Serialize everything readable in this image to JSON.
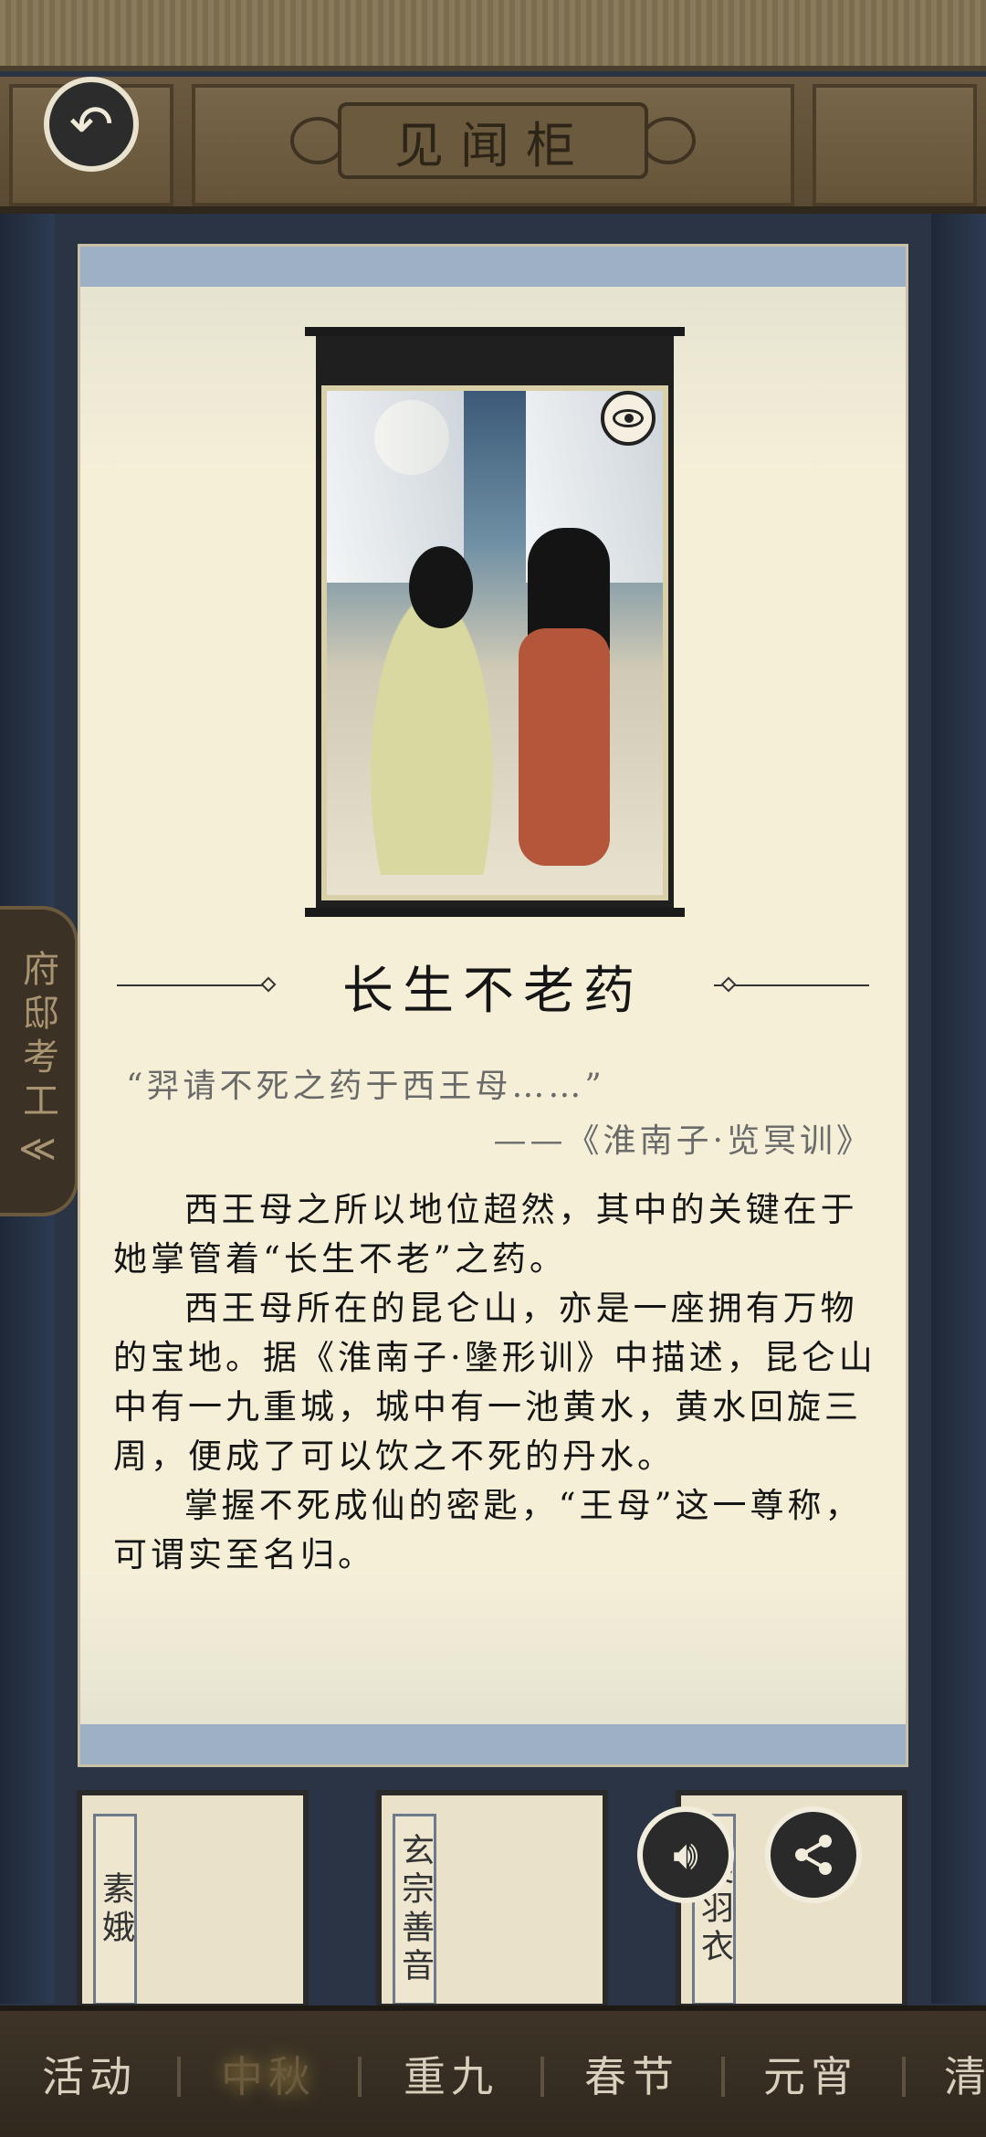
{
  "header": {
    "title": "见闻柜"
  },
  "side_tab": {
    "label": "府邸考工",
    "arrow": "≪"
  },
  "item": {
    "title": "长生不老药",
    "quote": "“羿请不死之药于西王母……”",
    "source": "——《淮南子·览冥训》",
    "paragraphs": [
      "西王母之所以地位超然，其中的关键在于她掌管着“长生不老”之药。",
      "西王母所在的昆仑山，亦是一座拥有万物的宝地。据《淮南子·墬形训》中描述，昆仑山中有一九重城，城中有一池黄水，黄水回旋三周，便成了可以饮之不死的丹水。",
      "掌握不死成仙的密匙，“王母”这一尊称，可谓实至名归。"
    ]
  },
  "cards": [
    {
      "label": "素娥"
    },
    {
      "label": "玄宗善音"
    },
    {
      "label": "裳羽衣"
    }
  ],
  "tabs": [
    {
      "label": "活动",
      "active": false
    },
    {
      "label": "中秋",
      "active": true
    },
    {
      "label": "重九",
      "active": false
    },
    {
      "label": "春节",
      "active": false
    },
    {
      "label": "元宵",
      "active": false
    },
    {
      "label": "清",
      "active": false
    }
  ],
  "icons": {
    "back": "back-arrow-icon",
    "view": "eye-icon",
    "sound": "speaker-icon",
    "share": "share-icon"
  },
  "colors": {
    "scroll_paper": "#f5efd8",
    "scroll_rod": "#9eb0c4",
    "wood": "#6b5a40",
    "active_tab": "#6a5a3e"
  }
}
